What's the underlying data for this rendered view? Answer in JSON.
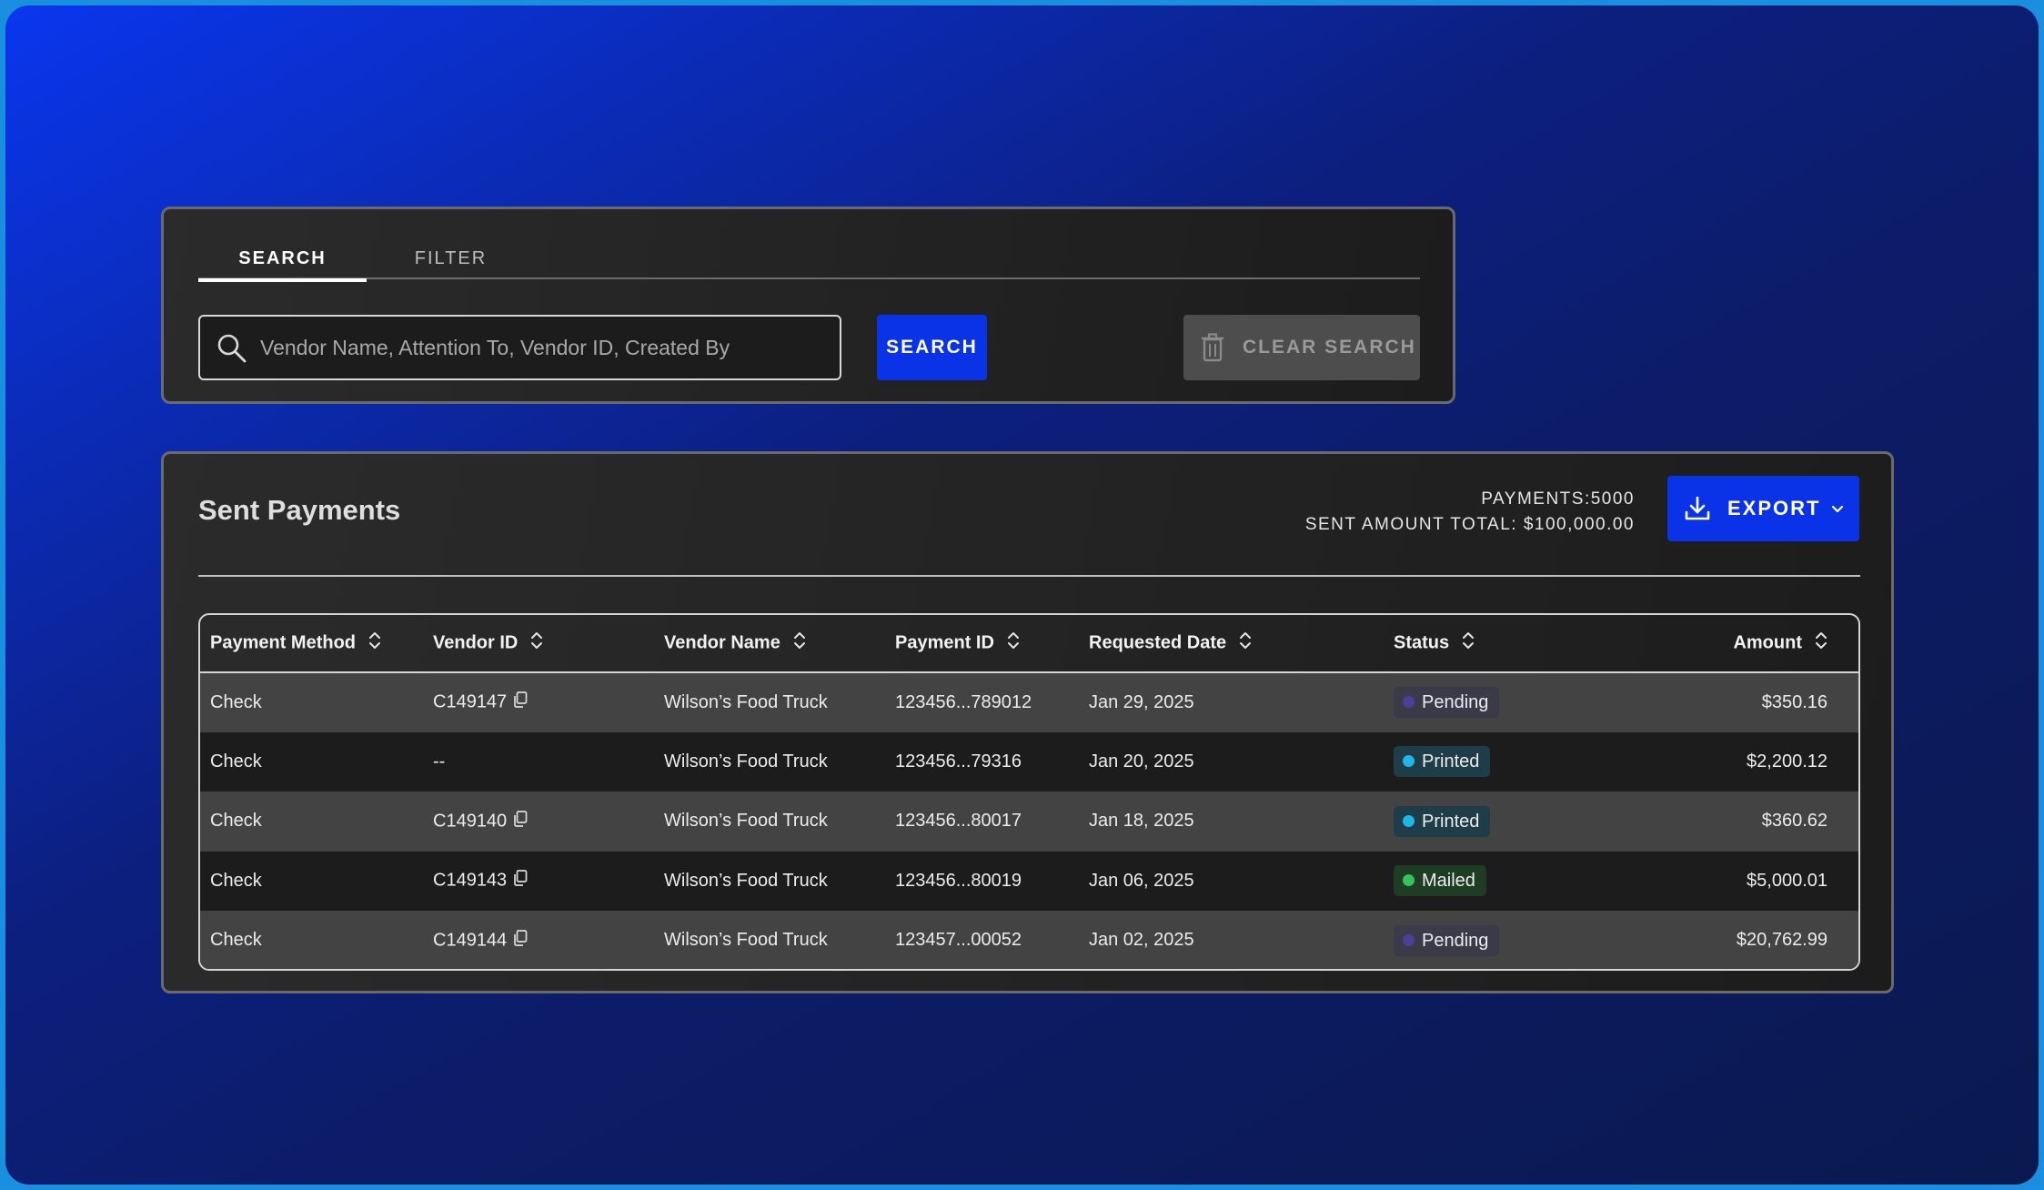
{
  "search_card": {
    "tabs": [
      {
        "label": "SEARCH",
        "active": true
      },
      {
        "label": "FILTER",
        "active": false
      }
    ],
    "search_placeholder": "Vendor Name, Attention To, Vendor ID, Created By",
    "search_value": "",
    "search_button": "SEARCH",
    "clear_button": "CLEAR SEARCH"
  },
  "payments": {
    "title": "Sent Payments",
    "payments_count": "PAYMENTS:5000",
    "sent_total": "SENT AMOUNT TOTAL: $100,000.00",
    "export_button": "EXPORT",
    "columns": [
      "Payment Method",
      "Vendor ID",
      "Vendor Name",
      "Payment ID",
      "Requested Date",
      "Status",
      "Amount"
    ],
    "rows": [
      {
        "method": "Check",
        "vendor_id": "C149147",
        "has_copy": true,
        "vendor_name": "Wilson’s Food Truck",
        "payment_id": "123456...789012",
        "date": "Jan 29, 2025",
        "status": "Pending",
        "amount": "$350.16"
      },
      {
        "method": "Check",
        "vendor_id": "--",
        "has_copy": false,
        "vendor_name": "Wilson’s Food Truck",
        "payment_id": "123456...79316",
        "date": "Jan 20, 2025",
        "status": "Printed",
        "amount": "$2,200.12"
      },
      {
        "method": "Check",
        "vendor_id": "C149140",
        "has_copy": true,
        "vendor_name": "Wilson’s Food Truck",
        "payment_id": "123456...80017",
        "date": "Jan 18, 2025",
        "status": "Printed",
        "amount": "$360.62"
      },
      {
        "method": "Check",
        "vendor_id": "C149143",
        "has_copy": true,
        "vendor_name": "Wilson’s Food Truck",
        "payment_id": "123456...80019",
        "date": "Jan 06, 2025",
        "status": "Mailed",
        "amount": "$5,000.01"
      },
      {
        "method": "Check",
        "vendor_id": "C149144",
        "has_copy": true,
        "vendor_name": "Wilson’s Food Truck",
        "payment_id": "123457...00052",
        "date": "Jan 02, 2025",
        "status": "Pending",
        "amount": "$20,762.99"
      }
    ],
    "status_colors": {
      "Pending": {
        "bg": "#3a3a48",
        "dot": "#4b3f9c"
      },
      "Printed": {
        "bg": "#1e3d48",
        "dot": "#1fb6e8"
      },
      "Mailed": {
        "bg": "#1f3d25",
        "dot": "#35c45a"
      }
    },
    "icons": [
      "search-icon",
      "trash-icon",
      "download-icon",
      "chevron-down-icon",
      "sort-icon",
      "copy-icon"
    ]
  }
}
